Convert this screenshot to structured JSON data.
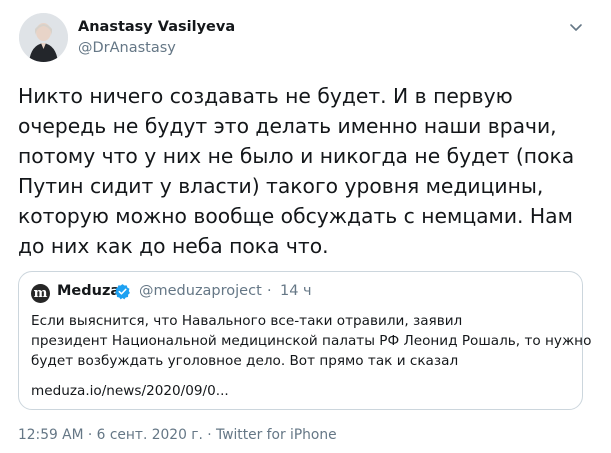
{
  "author": {
    "name": "Anastasy Vasilyeva",
    "handle": "@DrAnastasy"
  },
  "icons": {
    "menu": "chevron-down-icon",
    "verified": "verified-badge-icon"
  },
  "colors": {
    "text": "#14171a",
    "secondary": "#657786",
    "border": "#ccd6dd",
    "verified": "#1da1f2"
  },
  "tweet": {
    "lines": [
      "Никто ничего создавать не будет. И в первую",
      "очередь не будут это делать именно наши врачи,",
      "потому что у них не было и никогда не будет (пока",
      "Путин сидит у власти) такого уровня медицины,",
      "которую можно вообще обсуждать с немцами. Нам",
      "до них как до неба пока что."
    ]
  },
  "quote": {
    "logo_letter": "m",
    "name": "Meduza",
    "handle": "@meduzaproject",
    "separator": "·",
    "time": "14 ч",
    "lines": [
      "Если выяснится, что Навального все-таки отравили, заявил",
      "президент Национальной медицинской палаты РФ Леонид Рошаль, то нужно",
      "будет возбуждать уголовное дело. Вот прямо так и сказал"
    ],
    "link": "meduza.io/news/2020/09/0..."
  },
  "meta": {
    "time": "12:59 AM",
    "separator": " · ",
    "date": "6 сент. 2020 г.",
    "separator2": " · ",
    "source": "Twitter for iPhone"
  }
}
